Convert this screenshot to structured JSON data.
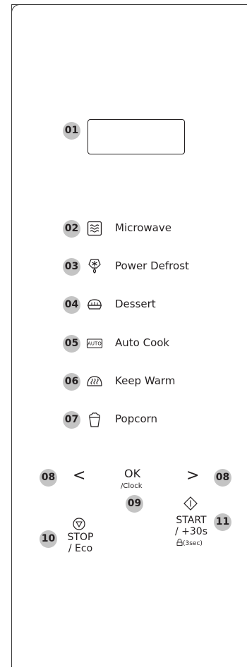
{
  "display_badge": "01",
  "modes": [
    {
      "num": "02",
      "icon": "microwave-icon",
      "label": "Microwave"
    },
    {
      "num": "03",
      "icon": "power-defrost-icon",
      "label": "Power Defrost"
    },
    {
      "num": "04",
      "icon": "dessert-icon",
      "label": "Dessert"
    },
    {
      "num": "05",
      "icon": "auto-cook-icon",
      "label": "Auto Cook"
    },
    {
      "num": "06",
      "icon": "keep-warm-icon",
      "label": "Keep Warm"
    },
    {
      "num": "07",
      "icon": "popcorn-icon",
      "label": "Popcorn"
    }
  ],
  "auto_icon_text": "AUTO",
  "nav": {
    "left_badge": "08",
    "right_badge": "08",
    "ok_label": "OK",
    "clock_label": "/Clock",
    "ok_badge": "09",
    "left_arrow": "<",
    "right_arrow": ">"
  },
  "stop": {
    "badge": "10",
    "line1": "STOP",
    "line2": "/ Eco",
    "icon": "stop-icon"
  },
  "start": {
    "badge": "11",
    "line1": "START",
    "line2": "/ +30s",
    "lock_text": "(3sec)",
    "icon": "start-icon",
    "lock_icon": "lock-icon"
  }
}
